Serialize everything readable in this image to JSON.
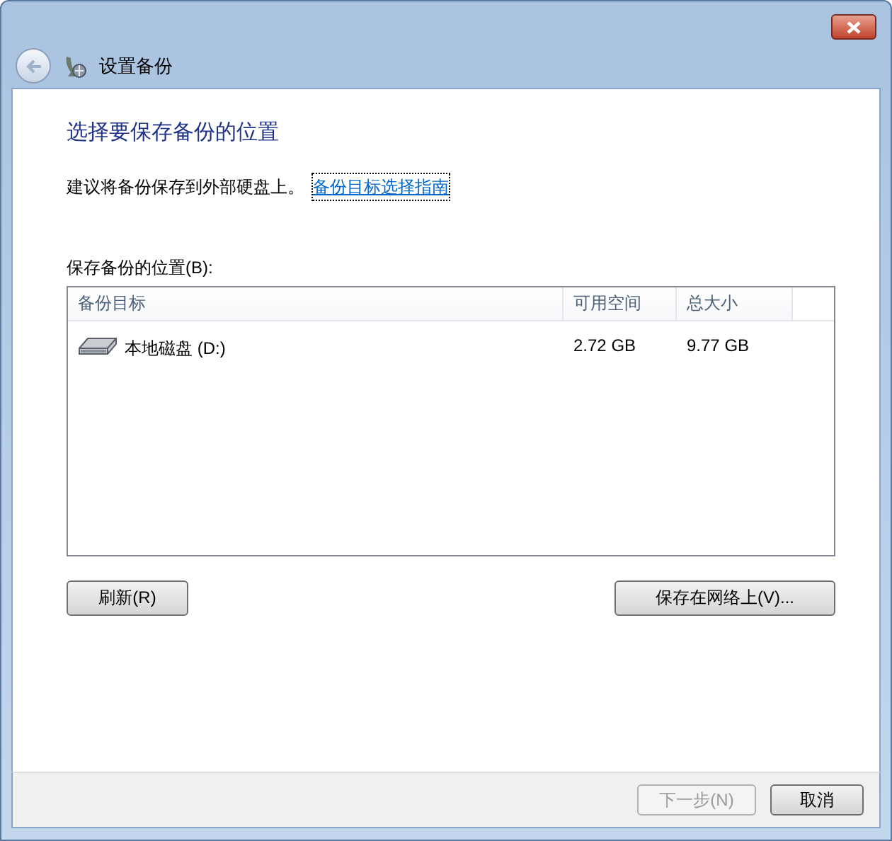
{
  "window": {
    "title": "设置备份"
  },
  "heading": "选择要保存备份的位置",
  "intro": {
    "text": "建议将备份保存到外部硬盘上。",
    "link": "备份目标选择指南"
  },
  "list_label": "保存备份的位置(B):",
  "table": {
    "columns": [
      "备份目标",
      "可用空间",
      "总大小"
    ],
    "rows": [
      {
        "cells": [
          "本地磁盘 (D:)",
          "2.72 GB",
          "9.77 GB"
        ]
      }
    ]
  },
  "actions": [
    {
      "label": "刷新(R)",
      "disabled": false
    },
    {
      "label": "保存在网络上(V)...",
      "disabled": false
    }
  ],
  "footer_buttons": [
    {
      "label": "下一步(N)",
      "disabled": true
    },
    {
      "label": "取消",
      "disabled": false
    }
  ]
}
